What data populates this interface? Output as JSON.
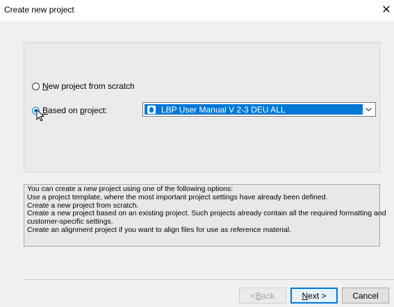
{
  "window": {
    "title": "Create new project",
    "close_glyph": "✕"
  },
  "options": {
    "scratch": {
      "mnemonic": "N",
      "rest": "ew project from scratch",
      "checked": false
    },
    "based": {
      "prefix": "",
      "mnemonic": "B",
      "rest": "ased on ",
      "mnemonic2": "p",
      "rest2": "roject:",
      "checked": true
    }
  },
  "project_select": {
    "value": "LBP User Manual V 2-3 DEU ALL",
    "icon": "project-icon"
  },
  "info_lines": [
    "You can create a new project using one of the following options:",
    "Use a project template, where the most important project settings have already been defined.",
    "Create a new project from scratch.",
    "Create a new project based on an existing project. Such projects already contain all the required formatting and",
    "customer-specific settings.",
    "Create an alignment project if you want to align files for use as reference material."
  ],
  "buttons": {
    "back": {
      "prefix": "< ",
      "mnemonic": "B",
      "rest": "ack",
      "enabled": false
    },
    "next": {
      "mnemonic": "N",
      "rest": "ext >",
      "default": true
    },
    "cancel": {
      "label": "Cancel"
    }
  },
  "colors": {
    "accent": "#0078d7",
    "dialog_bg": "#f0f0f0"
  }
}
